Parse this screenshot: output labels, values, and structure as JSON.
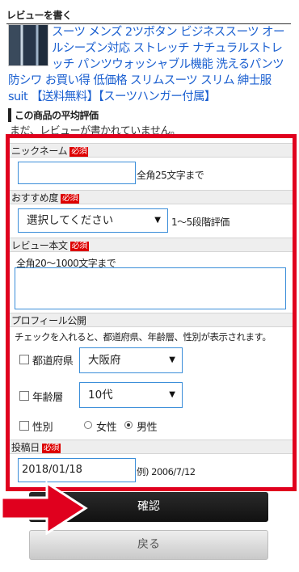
{
  "header": {
    "title": "レビューを書く"
  },
  "product": {
    "name": "スーツ メンズ 2ツボタン ビジネススーツ オールシーズン対応 ストレッチ ナチュラルストレッチ パンツウォッシャブル機能 洗えるパンツ 防シワ お買い得 低価格 スリムスーツ スリム 紳士服 suit 【送料無料】【スーツハンガー付属】"
  },
  "rating_section": {
    "title": "この商品の平均評価",
    "empty_text": "まだ、レビューが書かれていません。"
  },
  "form": {
    "required_badge": "必須",
    "nickname": {
      "label": "ニックネーム",
      "value": "",
      "hint": "全角25文字まで"
    },
    "recommend": {
      "label": "おすすめ度",
      "selected": "選択してください",
      "hint": "1〜5段階評価"
    },
    "body": {
      "label": "レビュー本文",
      "placeholder": "全角20〜1000文字まで"
    },
    "profile": {
      "label": "プロフィール公開",
      "note": "チェックを入れると、都道府県、年齢層、性別が表示されます。",
      "prefecture_label": "都道府県",
      "prefecture_selected": "大阪府",
      "age_label": "年齢層",
      "age_selected": "10代",
      "gender_label": "性別",
      "female": "女性",
      "male": "男性",
      "gender_selected": "男性"
    },
    "post_date": {
      "label": "投稿日",
      "value": "2018/01/18",
      "hint": "例) 2006/7/12"
    }
  },
  "buttons": {
    "confirm": "確認",
    "back": "戻る"
  },
  "colors": {
    "frame": "#e0001e",
    "link": "#1a5fd0",
    "required": "#dd0000"
  }
}
